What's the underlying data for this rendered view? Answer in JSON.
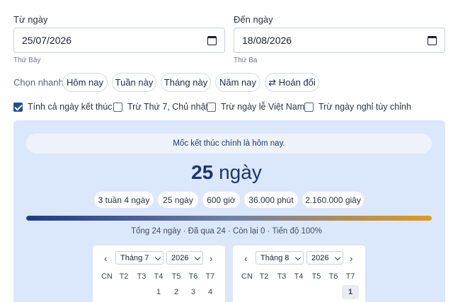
{
  "from": {
    "label": "Từ ngày",
    "value": "25/07/2026",
    "weekday": "Thứ Bảy"
  },
  "to": {
    "label": "Đến ngày",
    "value": "18/08/2026",
    "weekday": "Thứ Ba"
  },
  "quick": {
    "label": "Chọn nhanh:",
    "chips": [
      "Hôm nay",
      "Tuần này",
      "Tháng này",
      "Năm nay",
      "⇄ Hoán đổi"
    ]
  },
  "options": [
    {
      "label": "Tính cả ngày kết thúc",
      "checked": true
    },
    {
      "label": "Trừ Thứ 7, Chủ nhật",
      "checked": false
    },
    {
      "label": "Trừ ngày lễ Việt Nam",
      "checked": false
    },
    {
      "label": "Trừ ngày nghỉ tùy chỉnh",
      "checked": false
    }
  ],
  "result": {
    "notice": "Mốc kết thúc chính là hôm nay.",
    "days_number": "25",
    "days_unit": "ngày",
    "units": [
      "3 tuần 4 ngày",
      "25 ngày",
      "600 giờ",
      "36.000 phút",
      "2.160.000 giây"
    ],
    "progress_percent": 100,
    "summary": "Tổng 24 ngày · Đã qua 24 · Còn lại 0 · Tiến độ 100%"
  },
  "calendars": [
    {
      "month": "Tháng 7",
      "year": "2026",
      "weekdays": [
        "CN",
        "T2",
        "T3",
        "T4",
        "T5",
        "T6",
        "T7"
      ],
      "first_row": [
        "",
        "",
        "",
        "1",
        "2",
        "3",
        "4"
      ]
    },
    {
      "month": "Tháng 8",
      "year": "2026",
      "weekdays": [
        "CN",
        "T2",
        "T3",
        "T4",
        "T5",
        "T6",
        "T7"
      ],
      "first_row": [
        "",
        "",
        "",
        "",
        "",
        "",
        "1"
      ]
    }
  ],
  "colors": {
    "accent": "#1e4e9d",
    "panel": "#dbe7fb",
    "progress_start": "#1f3c82",
    "progress_end": "#e59a16"
  }
}
